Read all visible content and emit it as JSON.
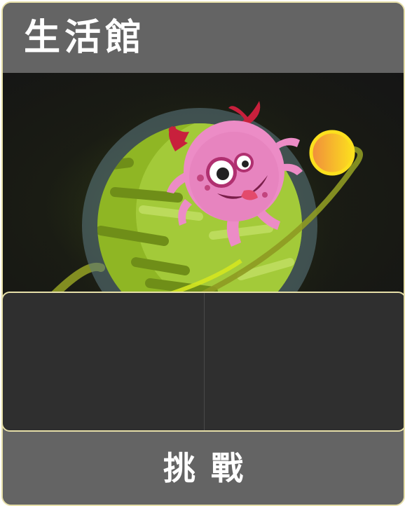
{
  "card": {
    "title": "生活館",
    "challenge_label": "挑戰",
    "border_color": "#e6dfa8",
    "header_color": "#646464",
    "panel_color": "#2f2f2f"
  },
  "illustration": {
    "subject": "pink-monster-on-green-planet",
    "planet_color": "#a5cc34",
    "monster_color": "#ec8cc6",
    "sun_color": "#fcd21e"
  },
  "info_panel": {
    "cells": [
      "",
      ""
    ]
  }
}
